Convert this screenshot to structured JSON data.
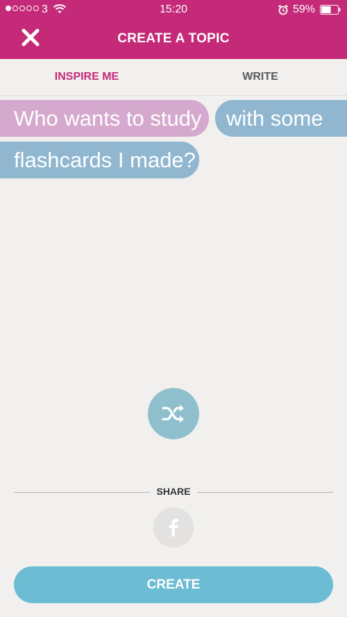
{
  "status_bar": {
    "carrier": "3",
    "time": "15:20",
    "battery": "59%",
    "battery_level": 0.59
  },
  "header": {
    "title": "CREATE A TOPIC",
    "close_icon": "close-icon"
  },
  "tabs": [
    {
      "label": "INSPIRE ME",
      "active": true
    },
    {
      "label": "WRITE",
      "active": false
    }
  ],
  "suggestion": {
    "chips": [
      {
        "text": "Who wants to study",
        "color": "#d5a9cd"
      },
      {
        "text": "with some",
        "color": "#90b7cf"
      },
      {
        "text": "flashcards I made?",
        "color": "#90b7cf"
      }
    ]
  },
  "shuffle": {
    "icon": "shuffle-icon",
    "color": "#8fbfcc"
  },
  "share": {
    "label": "SHARE",
    "icons": [
      "facebook-icon"
    ]
  },
  "create_button": {
    "label": "CREATE",
    "color": "#6cbcd4"
  },
  "colors": {
    "brand": "#c42a78",
    "background": "#f1f0ee"
  }
}
